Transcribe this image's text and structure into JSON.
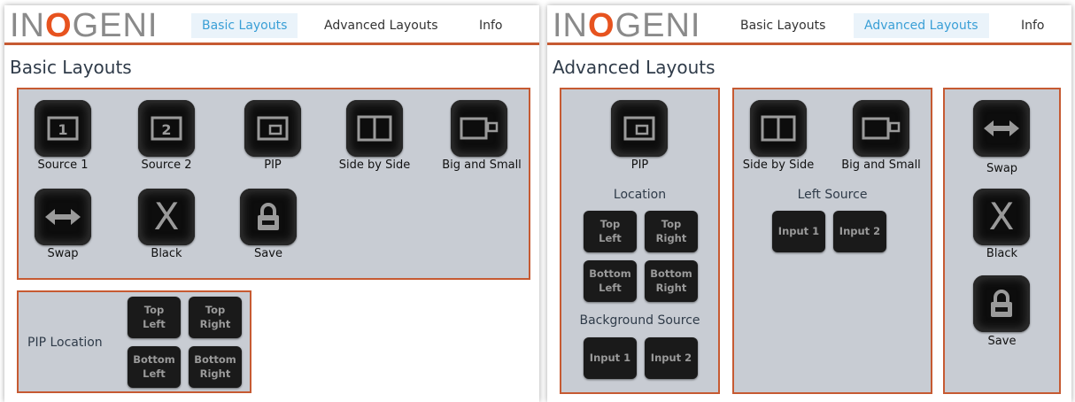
{
  "brand": {
    "logo_prefix": "IN",
    "logo_o": "O",
    "logo_suffix": "GENI"
  },
  "colors": {
    "accent": "#c65a32",
    "active_tab": "#3a9fd6",
    "panel_bg": "#c8ccd3",
    "button_bg": "#0d0d0d"
  },
  "left": {
    "tabs": [
      "Basic Layouts",
      "Advanced Layouts",
      "Info"
    ],
    "active_tab": "Basic Layouts",
    "title": "Basic Layouts",
    "layouts": [
      {
        "label": "Source 1",
        "icon": "source-1-icon",
        "glyph": "1"
      },
      {
        "label": "Source 2",
        "icon": "source-2-icon",
        "glyph": "2"
      },
      {
        "label": "PIP",
        "icon": "pip-icon"
      },
      {
        "label": "Side by Side",
        "icon": "side-by-side-icon"
      },
      {
        "label": "Big and Small",
        "icon": "big-and-small-icon"
      },
      {
        "label": "Swap",
        "icon": "swap-icon"
      },
      {
        "label": "Black",
        "icon": "black-icon",
        "glyph": "X"
      },
      {
        "label": "Save",
        "icon": "lock-icon"
      }
    ],
    "pip_location": {
      "label": "PIP Location",
      "buttons": [
        "Top\nLeft",
        "Top\nRight",
        "Bottom\nLeft",
        "Bottom\nRight"
      ]
    }
  },
  "right": {
    "tabs": [
      "Basic Layouts",
      "Advanced Layouts",
      "Info"
    ],
    "active_tab": "Advanced Layouts",
    "title": "Advanced Layouts",
    "pip": {
      "label": "PIP",
      "icon": "pip-icon"
    },
    "location": {
      "label": "Location",
      "buttons": [
        "Top\nLeft",
        "Top\nRight",
        "Bottom\nLeft",
        "Bottom\nRight"
      ]
    },
    "background_source": {
      "label": "Background Source",
      "buttons": [
        "Input 1",
        "Input 2"
      ]
    },
    "side_by_side": {
      "label": "Side by Side",
      "icon": "side-by-side-icon"
    },
    "big_and_small": {
      "label": "Big and Small",
      "icon": "big-and-small-icon"
    },
    "left_source": {
      "label": "Left Source",
      "buttons": [
        "Input 1",
        "Input 2"
      ]
    },
    "swap": {
      "label": "Swap",
      "icon": "swap-icon"
    },
    "black": {
      "label": "Black",
      "icon": "black-icon",
      "glyph": "X"
    },
    "save": {
      "label": "Save",
      "icon": "lock-icon"
    }
  }
}
